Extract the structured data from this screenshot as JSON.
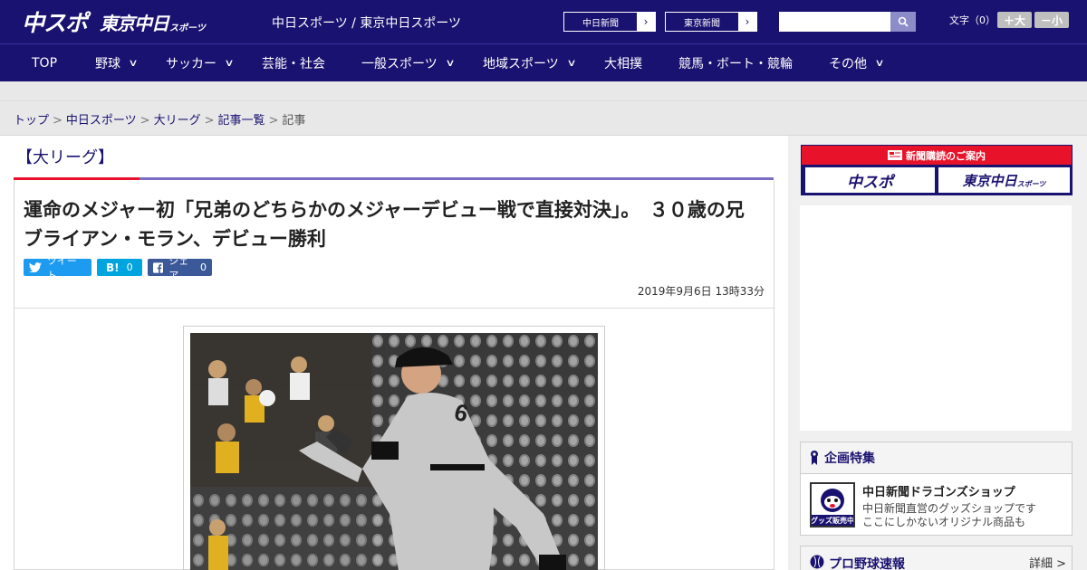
{
  "header": {
    "logo_main": "中スポ",
    "logo_sub": "東京中日",
    "logo_sub_small": "スポーツ",
    "site_names": "中日スポーツ / 東京中日スポーツ",
    "btn_chunichi": "中日新聞",
    "btn_tokyo": "東京新聞",
    "search_placeholder": "",
    "fontsize_label": "文字（0）",
    "fontsize_bigger": "＋大",
    "fontsize_smaller": "－小"
  },
  "nav": {
    "top": "TOP",
    "baseball": "野球",
    "soccer": "サッカー",
    "entertainment": "芸能・社会",
    "general_sports": "一般スポーツ",
    "local_sports": "地域スポーツ",
    "sumo": "大相撲",
    "racing": "競馬・ボート・競輪",
    "other": "その他",
    "chevron": "∨"
  },
  "breadcrumb": {
    "home": "トップ",
    "chunichi": "中日スポーツ",
    "mlb": "大リーグ",
    "list": "記事一覧",
    "current": "記事",
    "sep": ">"
  },
  "article": {
    "category": "【大リーグ】",
    "title": "運命のメジャー初「兄弟のどちらかのメジャーデビュー戦で直接対決」。　３０歳の兄ブライアン・モラン、デビュー勝利",
    "tweet_label": "ツイート",
    "hatena_label": "B!",
    "hatena_count": "0",
    "fb_label": "シェア",
    "fb_count": "0",
    "date": "2019年9月6日 13時33分"
  },
  "sidebar": {
    "subscription_title": "新聞購読のご案内",
    "sub_btn_chuspo": "中スポ",
    "sub_btn_tokyo": "東京中日",
    "sub_btn_tokyo_small": "スポーツ",
    "feature_title": "企画特集",
    "feature_name": "中日新聞ドラゴンズショップ",
    "feature_desc1": "中日新聞直営のグッズショップです",
    "feature_desc2": "ここにしかないオリジナル商品も",
    "feature_thumb_text": "グッズ販売中",
    "baseball_title": "プロ野球速報",
    "baseball_detail": "詳細 >"
  },
  "colors": {
    "brand_navy": "#1a1270",
    "accent_red": "#e8132b",
    "twitter_blue": "#1d9bf0",
    "hatena_blue": "#00a4de",
    "facebook_blue": "#3b5998"
  }
}
